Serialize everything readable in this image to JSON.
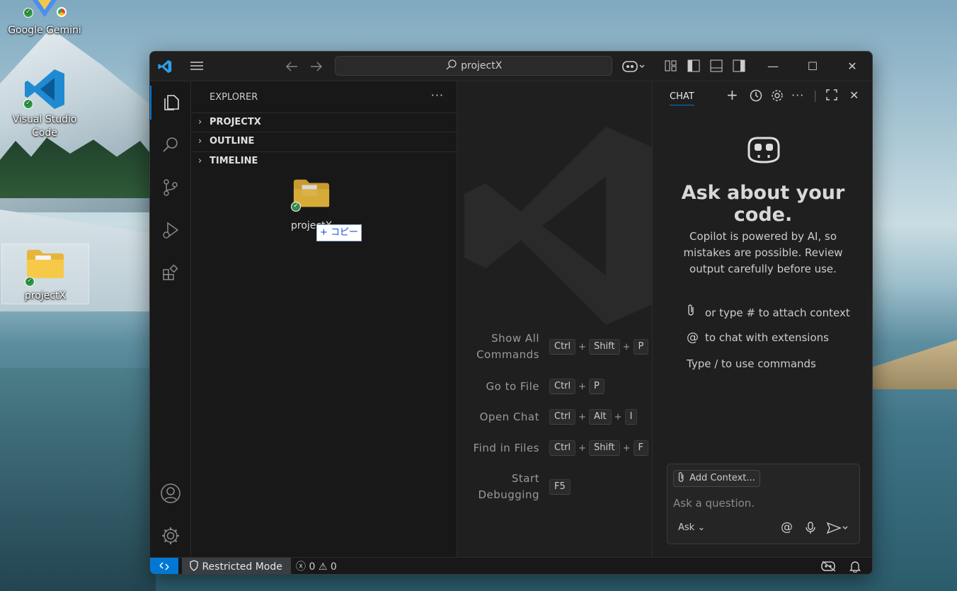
{
  "desktop": {
    "icons": [
      {
        "label": "Google Gemini"
      },
      {
        "label": "Visual Studio Code"
      },
      {
        "label": "projectX"
      }
    ]
  },
  "titlebar": {
    "search_text": "projectX"
  },
  "sidebar": {
    "title": "EXPLORER",
    "sections": [
      "PROJECTX",
      "OUTLINE",
      "TIMELINE"
    ],
    "drag_label": "projectX",
    "drag_tooltip": "+ コピー"
  },
  "editor": {
    "shortcuts": [
      {
        "label": "Show All Commands",
        "keys": [
          "Ctrl",
          "Shift",
          "P"
        ]
      },
      {
        "label": "Go to File",
        "keys": [
          "Ctrl",
          "P"
        ]
      },
      {
        "label": "Open Chat",
        "keys": [
          "Ctrl",
          "Alt",
          "I"
        ]
      },
      {
        "label": "Find in Files",
        "keys": [
          "Ctrl",
          "Shift",
          "F"
        ]
      },
      {
        "label": "Start Debugging",
        "keys": [
          "F5"
        ]
      }
    ]
  },
  "chat": {
    "tab_label": "CHAT",
    "title": "Ask about your code.",
    "description": "Copilot is powered by AI, so mistakes are possible. Review output carefully before use.",
    "hints": [
      {
        "icon": "paperclip-icon",
        "text": "or type # to attach context"
      },
      {
        "icon": "at-icon",
        "text": "to chat with extensions"
      },
      {
        "icon": "",
        "text": "Type / to use commands"
      }
    ],
    "add_context": "Add Context...",
    "input_placeholder": "Ask a question.",
    "mode": "Ask"
  },
  "statusbar": {
    "restricted": "Restricted Mode",
    "errors": "0",
    "warnings": "0"
  },
  "colors": {
    "accent": "#0078d4",
    "background": "#1f1f1f",
    "sidebar": "#181818"
  }
}
